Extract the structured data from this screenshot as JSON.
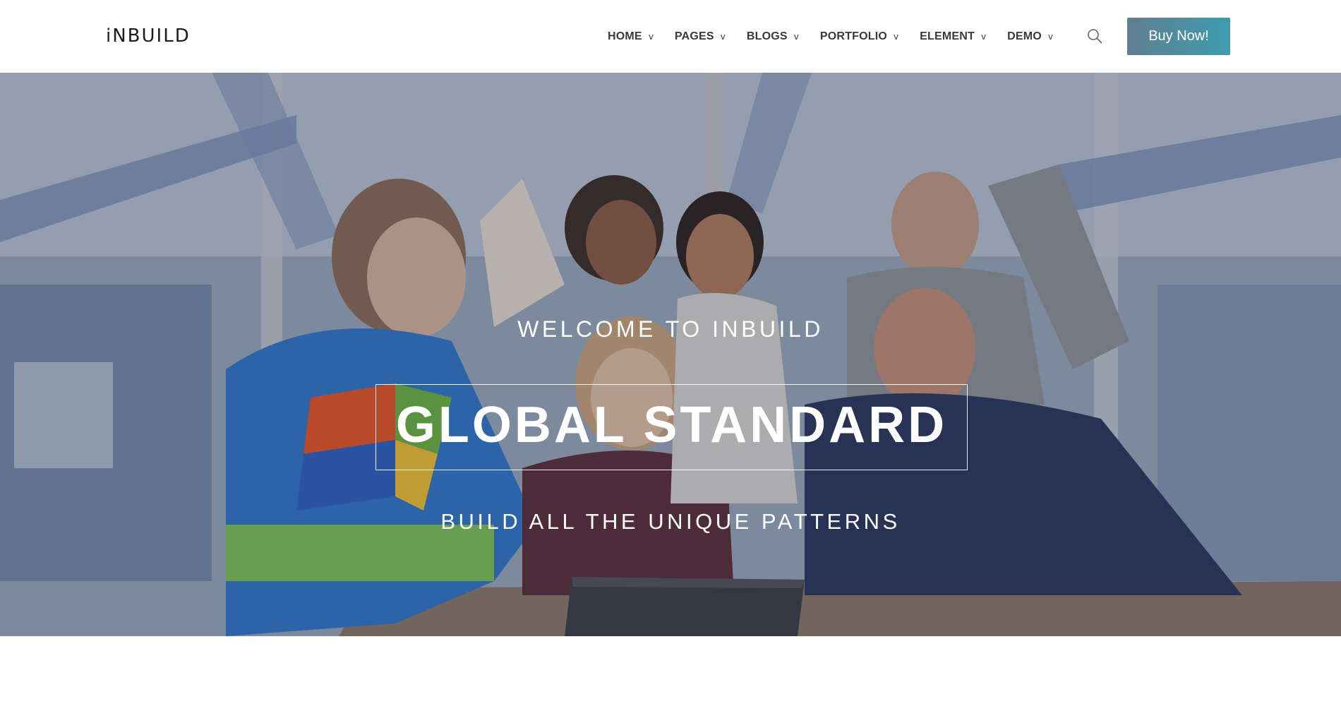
{
  "brand": {
    "logo": "iNBUILD"
  },
  "nav": {
    "items": [
      {
        "label": "HOME",
        "caret": "v"
      },
      {
        "label": "PAGES",
        "caret": "v"
      },
      {
        "label": "BLOGS",
        "caret": "v"
      },
      {
        "label": "PORTFOLIO",
        "caret": "v"
      },
      {
        "label": "ELEMENT",
        "caret": "v"
      },
      {
        "label": "DEMO",
        "caret": "v"
      }
    ],
    "search_icon": "search-icon",
    "cta_label": "Buy Now!"
  },
  "hero": {
    "welcome": "WELCOME TO INBUILD",
    "title": "GLOBAL STANDARD",
    "subtitle": "BUILD ALL THE UNIQUE PATTERNS",
    "image": "team-celebrating-photo"
  },
  "colors": {
    "button_gradient_start": "#5f7e90",
    "button_gradient_end": "#3e9cae",
    "nav_text": "#3a3a3a",
    "hero_text": "#ffffff"
  }
}
